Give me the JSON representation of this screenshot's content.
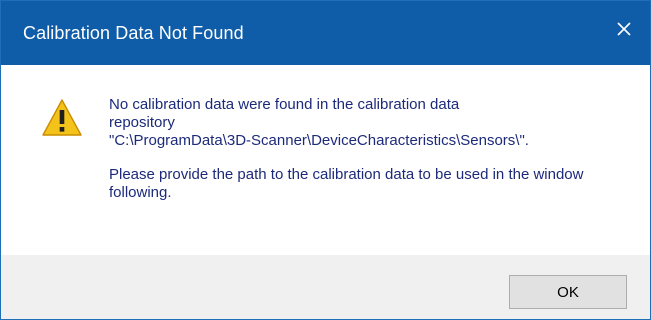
{
  "window": {
    "title": "Calibration Data Not Found",
    "close_icon": "close-icon"
  },
  "message": {
    "icon": "warning-icon",
    "line1": "No calibration data were found in the calibration data",
    "line2": "repository",
    "path": "\"C:\\ProgramData\\3D-Scanner\\DeviceCharacteristics\\Sensors\\\".",
    "paragraph2": "Please provide the path to the calibration data to be used in the window following."
  },
  "buttons": {
    "ok_label": "OK"
  },
  "colors": {
    "titlebar": "#0f5ca8",
    "message_text": "#1d2a7a",
    "footer": "#f0f0f0",
    "warning_fill": "#f3c21b"
  }
}
